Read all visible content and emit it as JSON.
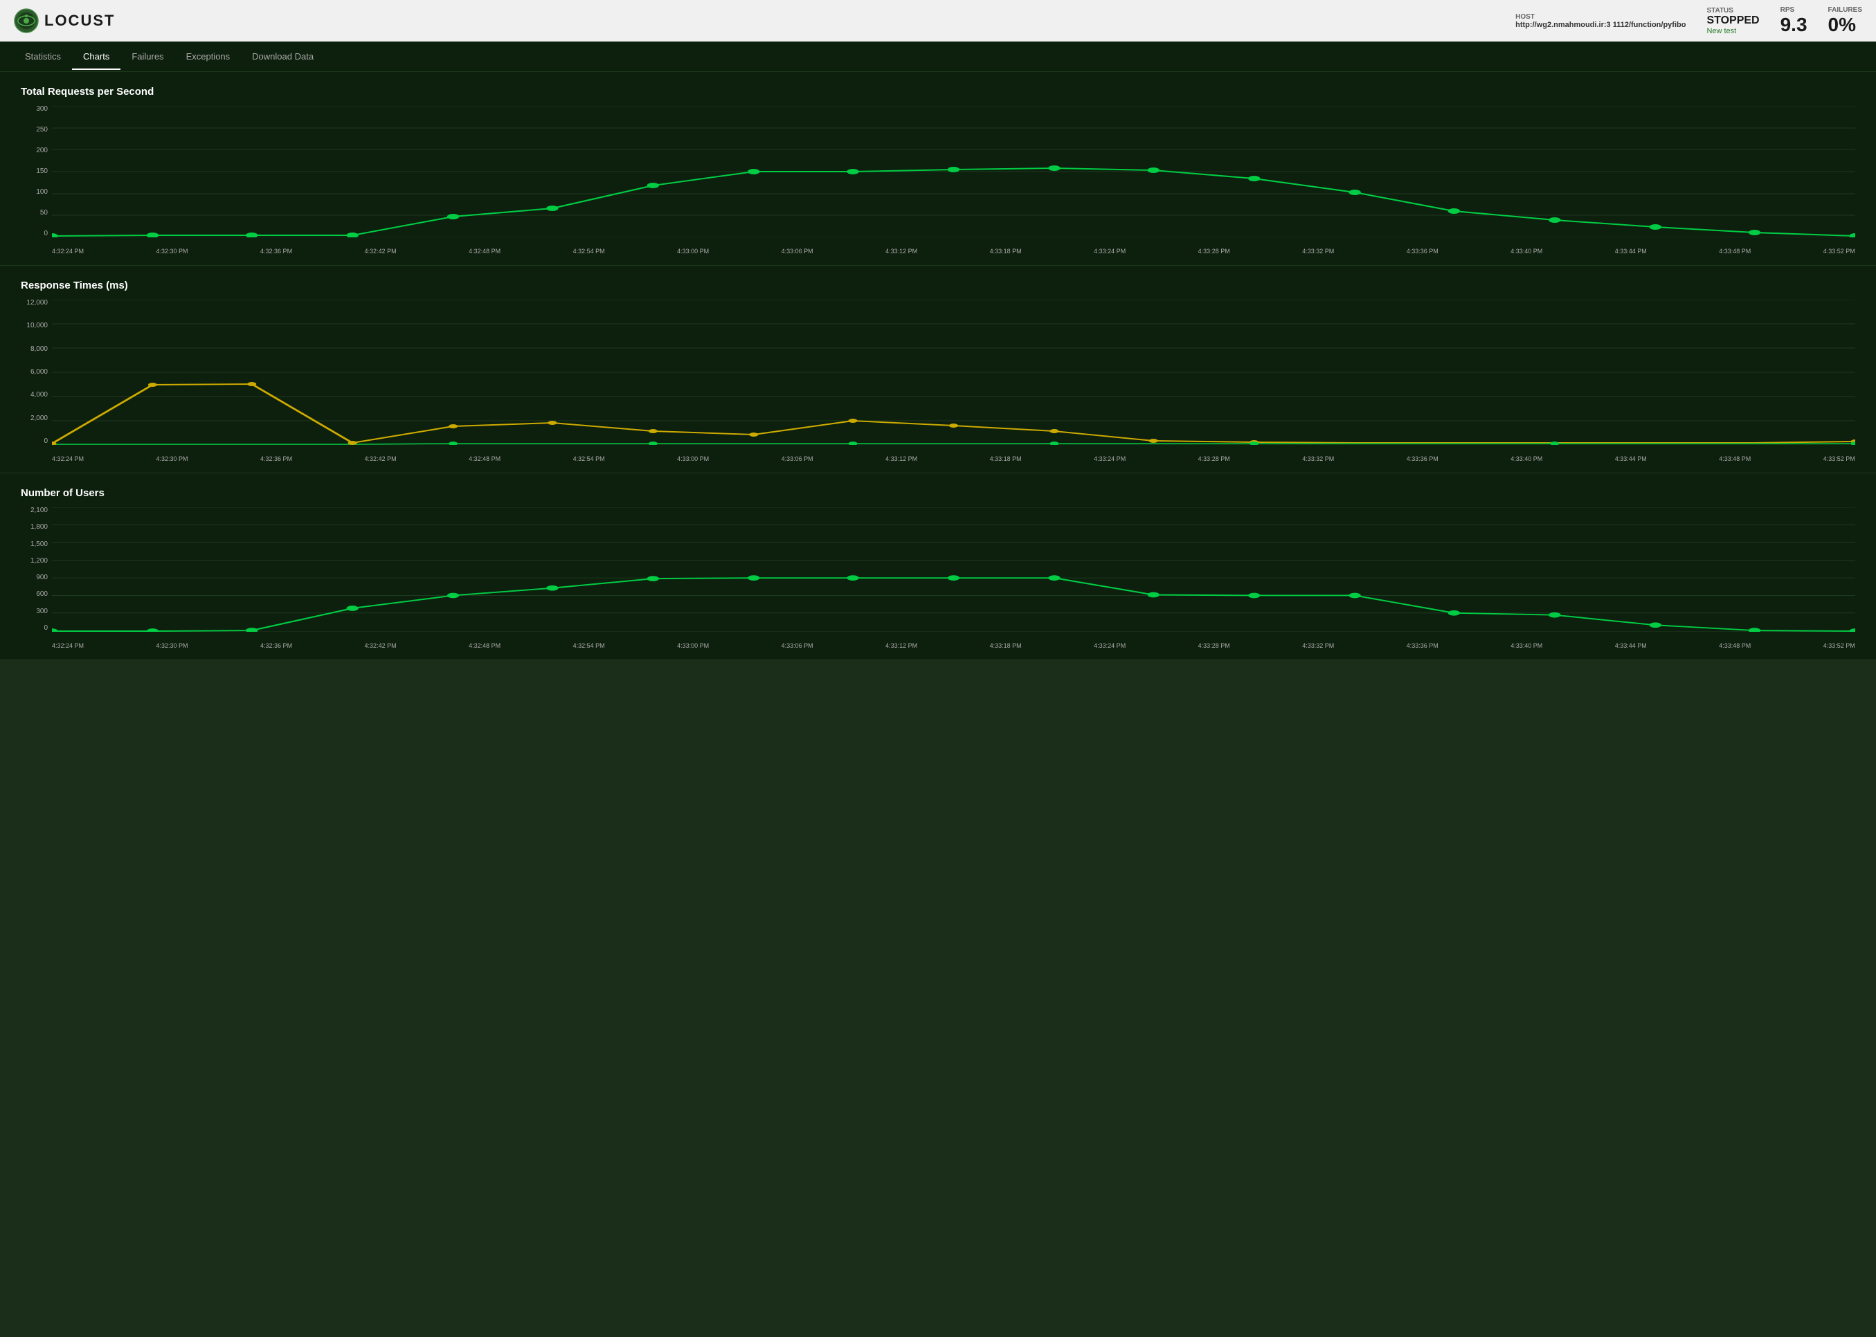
{
  "header": {
    "logo_text": "LOCUST",
    "host_label": "HOST",
    "host_value": "http://wg2.nmahmoudi.ir:3 1112/function/pyfibo",
    "status_label": "STATUS",
    "status_value": "STOPPED",
    "new_test_label": "New test",
    "rps_label": "RPS",
    "rps_value": "9.3",
    "failures_label": "FAILURES",
    "failures_value": "0%"
  },
  "nav": {
    "items": [
      {
        "id": "statistics",
        "label": "Statistics",
        "active": false
      },
      {
        "id": "charts",
        "label": "Charts",
        "active": true
      },
      {
        "id": "failures",
        "label": "Failures",
        "active": false
      },
      {
        "id": "exceptions",
        "label": "Exceptions",
        "active": false
      },
      {
        "id": "download-data",
        "label": "Download Data",
        "active": false
      }
    ]
  },
  "charts": {
    "rps": {
      "title": "Total Requests per Second",
      "y_labels": [
        "300",
        "250",
        "200",
        "150",
        "100",
        "50",
        "0"
      ],
      "x_labels": [
        "4:32:24 PM",
        "4:32:30 PM",
        "4:32:36 PM",
        "4:32:42 PM",
        "4:32:48 PM",
        "4:32:54 PM",
        "4:33:00 PM",
        "4:33:06 PM",
        "4:33:12 PM",
        "4:33:18 PM",
        "4:33:24 PM",
        "4:33:28 PM",
        "4:33:32 PM",
        "4:33:36 PM",
        "4:33:40 PM",
        "4:33:44 PM",
        "4:33:48 PM",
        "4:33:52 PM"
      ]
    },
    "response_times": {
      "title": "Response Times (ms)",
      "y_labels": [
        "12,000",
        "10,000",
        "8,000",
        "6,000",
        "4,000",
        "2,000",
        "0"
      ],
      "x_labels": [
        "4:32:24 PM",
        "4:32:30 PM",
        "4:32:36 PM",
        "4:32:42 PM",
        "4:32:48 PM",
        "4:32:54 PM",
        "4:33:00 PM",
        "4:33:06 PM",
        "4:33:12 PM",
        "4:33:18 PM",
        "4:33:24 PM",
        "4:33:28 PM",
        "4:33:32 PM",
        "4:33:36 PM",
        "4:33:40 PM",
        "4:33:44 PM",
        "4:33:48 PM",
        "4:33:52 PM"
      ]
    },
    "users": {
      "title": "Number of Users",
      "y_labels": [
        "2,100",
        "1,800",
        "1,500",
        "1,200",
        "900",
        "600",
        "300",
        "0"
      ],
      "x_labels": [
        "4:32:24 PM",
        "4:32:30 PM",
        "4:32:36 PM",
        "4:32:42 PM",
        "4:32:48 PM",
        "4:32:54 PM",
        "4:33:00 PM",
        "4:33:06 PM",
        "4:33:12 PM",
        "4:33:18 PM",
        "4:33:24 PM",
        "4:33:28 PM",
        "4:33:32 PM",
        "4:33:36 PM",
        "4:33:40 PM",
        "4:33:44 PM",
        "4:33:48 PM",
        "4:33:52 PM"
      ]
    }
  }
}
